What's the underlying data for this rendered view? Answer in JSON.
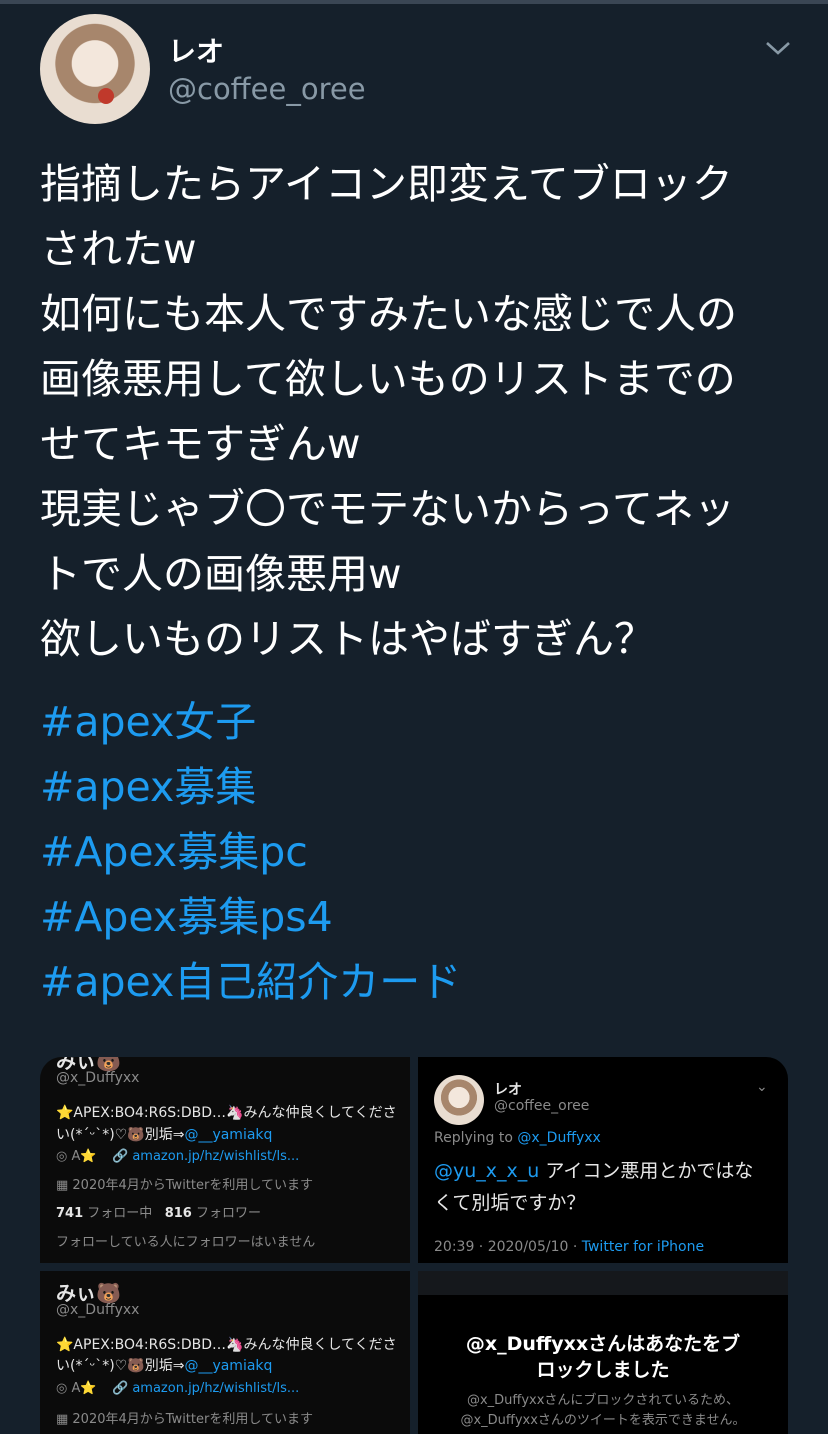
{
  "tweet": {
    "name": "レオ",
    "handle": "@coffee_oree",
    "text": "指摘したらアイコン即変えてブロック\nされたw\n如何にも本人ですみたいな感じで人の\n画像悪用して欲しいものリストまでの\nせてキモすぎんw\n現実じゃブ〇でモテないからってネッ\nトで人の画像悪用w\n欲しいものリストはやばすぎん？",
    "hashtags": [
      "#apex女子",
      "#apex募集",
      "#Apex募集pc",
      "#Apex募集ps4",
      "#apex自己紹介カード"
    ]
  },
  "images": {
    "profile1": {
      "top_partial": "みぃ🐻",
      "handle": "@x_Duffyxx",
      "bio_line1": "⭐APEX:BO4:R6S:DBD…🦄みんな仲良くしてくださ",
      "bio_line2": "い(*´ᵕ`*)♡🐻別垢⇒",
      "bio_mention": "@__yamiakq",
      "meta_loc": "◎ A⭐",
      "link": "amazon.jp/hz/wishlist/ls...",
      "joined": "▦ 2020年4月からTwitterを利用しています",
      "following_count": "741",
      "following_label": "フォロー中",
      "followers_count": "816",
      "followers_label": "フォロワー",
      "no_mutual": "フォローしている人にフォロワーはいません"
    },
    "reply": {
      "name": "レオ",
      "handle": "@coffee_oree",
      "replying_label": "Replying to",
      "replying_to": "@x_Duffyxx",
      "mention": "@yu_x_x_u",
      "text_line1": " アイコン悪用とかではな",
      "text_line2": "くて別垢ですか？",
      "time": "20:39 · 2020/05/10 · ",
      "client": "Twitter for iPhone"
    },
    "profile2": {
      "name": "みぃ🐻",
      "handle": "@x_Duffyxx",
      "bio_line1": "⭐APEX:BO4:R6S:DBD…🦄みんな仲良くしてくださ",
      "bio_line2": "い(*´ᵕ`*)♡🐻別垢⇒",
      "bio_mention": "@__yamiakq",
      "meta_loc": "◎ A⭐",
      "link": "amazon.jp/hz/wishlist/ls...",
      "joined": "▦ 2020年4月からTwitterを利用しています"
    },
    "blocked": {
      "title_line1": "@x_Duffyxxさんはあなたをブ",
      "title_line2": "ロックしました",
      "sub_line1": "@x_Duffyxxさんにブロックされているため、",
      "sub_line2": "@x_Duffyxxさんのツイートを表示できません。"
    }
  },
  "colors": {
    "background": "#15202b",
    "link": "#1d9bf0",
    "muted": "#8899a6"
  }
}
